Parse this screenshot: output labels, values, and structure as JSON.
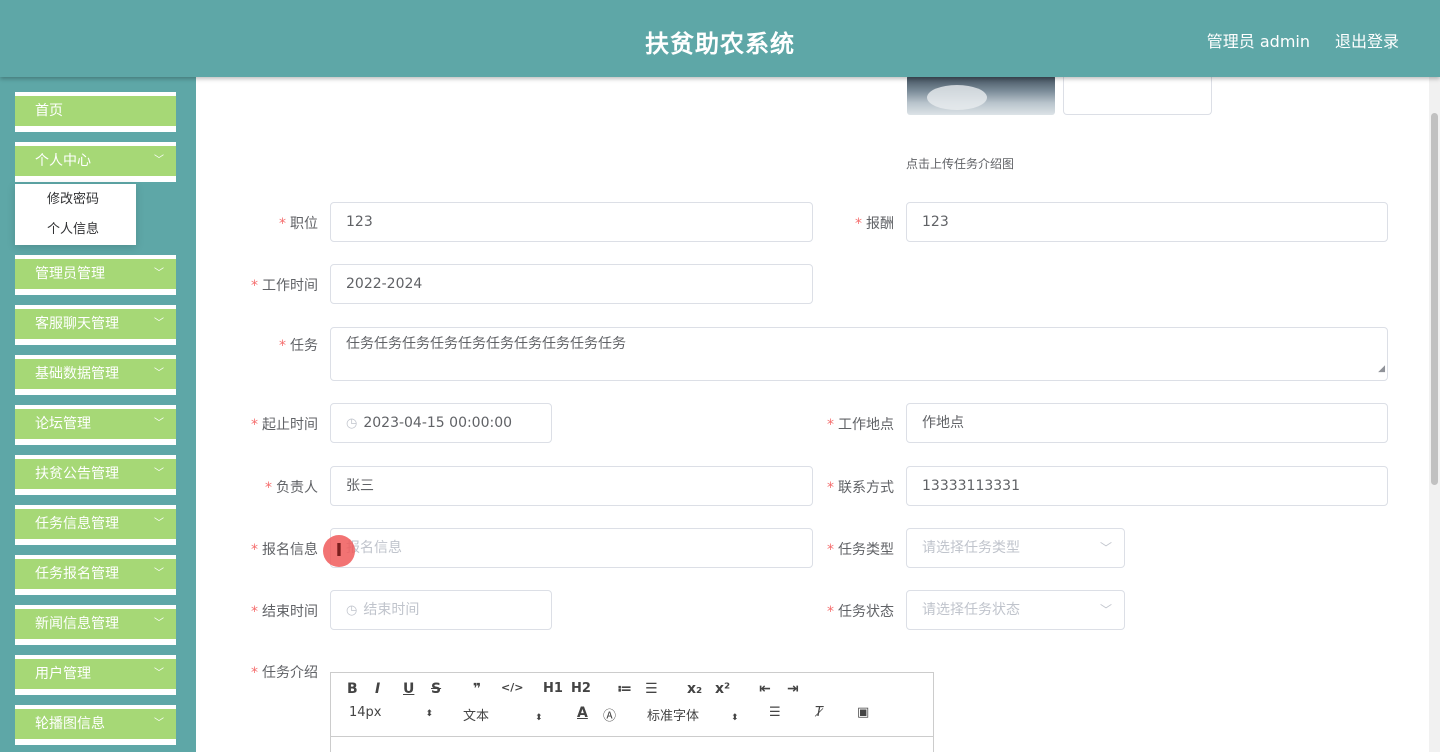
{
  "header": {
    "title": "扶贫助农系统",
    "user": "管理员 admin",
    "logout": "退出登录"
  },
  "sidebar": {
    "items": [
      {
        "label": "首页",
        "has_children": false
      },
      {
        "label": "个人中心",
        "has_children": true
      },
      {
        "label": "管理员管理",
        "has_children": true
      },
      {
        "label": "客服聊天管理",
        "has_children": true
      },
      {
        "label": "基础数据管理",
        "has_children": true
      },
      {
        "label": "论坛管理",
        "has_children": true
      },
      {
        "label": "扶贫公告管理",
        "has_children": true
      },
      {
        "label": "任务信息管理",
        "has_children": true
      },
      {
        "label": "任务报名管理",
        "has_children": true
      },
      {
        "label": "新闻信息管理",
        "has_children": true
      },
      {
        "label": "用户管理",
        "has_children": true
      },
      {
        "label": "轮播图信息",
        "has_children": true
      }
    ],
    "submenu": [
      "修改密码",
      "个人信息"
    ]
  },
  "form": {
    "upload_tip": "点击上传任务介绍图",
    "position_label": "职位",
    "position_value": "123",
    "salary_label": "报酬",
    "salary_value": "123",
    "worktime_label": "工作时间",
    "worktime_value": "2022-2024",
    "task_label": "任务",
    "task_value": "任务任务任务任务任务任务任务任务任务任务",
    "start_label": "起止时间",
    "start_value": "2023-04-15 00:00:00",
    "location_label": "工作地点",
    "location_value": "作地点",
    "owner_label": "负责人",
    "owner_value": "张三",
    "contact_label": "联系方式",
    "contact_value": "13333113331",
    "signup_label": "报名信息",
    "signup_placeholder": "报名信息",
    "type_label": "任务类型",
    "type_placeholder": "请选择任务类型",
    "end_label": "结束时间",
    "end_placeholder": "结束时间",
    "status_label": "任务状态",
    "status_placeholder": "请选择任务状态",
    "intro_label": "任务介绍",
    "required_mark": "*"
  },
  "editor": {
    "row1": [
      "B",
      "I",
      "U",
      "S",
      "❞",
      "</>",
      "H1",
      "H2",
      "≔",
      "☰",
      "x₂",
      "x²",
      "⇤",
      "⇥"
    ],
    "font_size": "14px",
    "block_type": "文本",
    "font_family": "标准字体"
  }
}
